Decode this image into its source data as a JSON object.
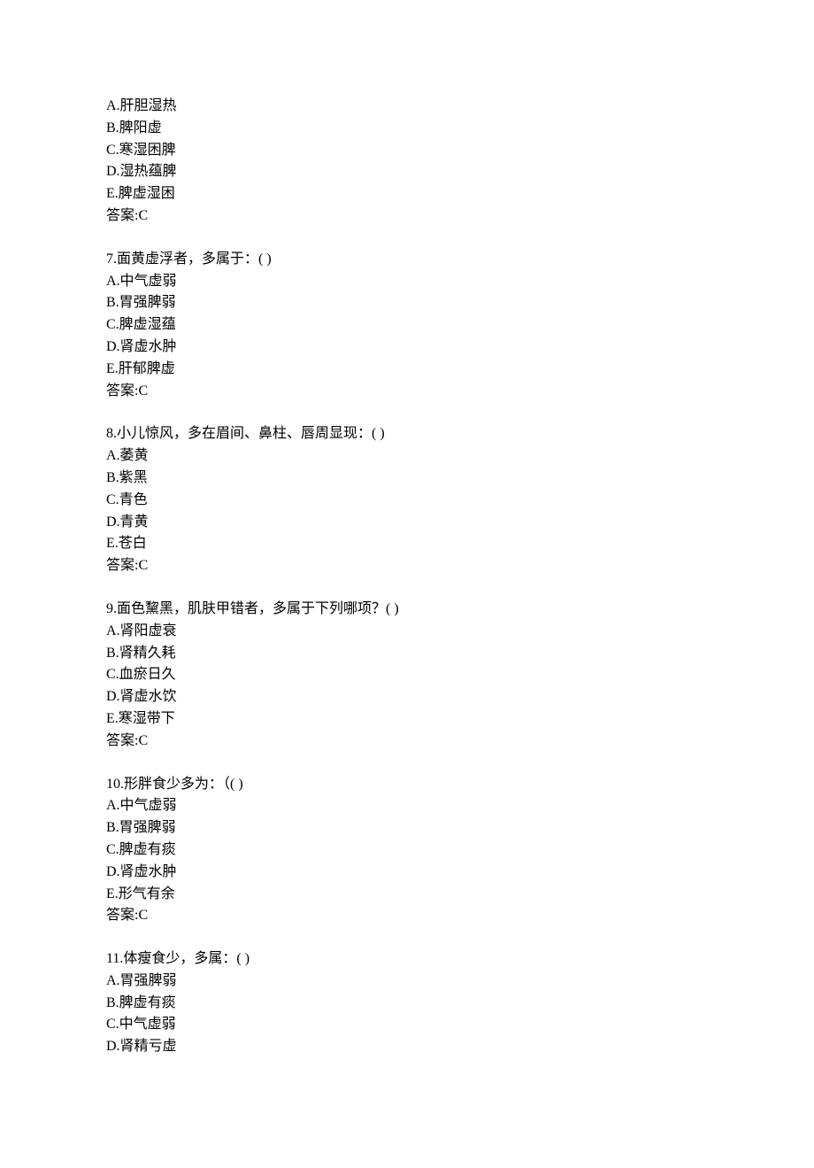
{
  "blocks": [
    {
      "lines": [
        "A.肝胆湿热",
        "B.脾阳虚",
        "C.寒湿困脾",
        "D.湿热蕴脾",
        "E.脾虚湿困",
        "答案:C"
      ]
    },
    {
      "lines": [
        "7.面黄虚浮者，多属于：( )",
        "A.中气虚弱",
        "B.胃强脾弱",
        "C.脾虚湿蕴",
        "D.肾虚水肿",
        "E.肝郁脾虚",
        "答案:C"
      ]
    },
    {
      "lines": [
        "8.小儿惊风，多在眉间、鼻柱、唇周显现：( )",
        "A.萎黄",
        "B.紫黑",
        "C.青色",
        "D.青黄",
        "E.苍白",
        "答案:C"
      ]
    },
    {
      "lines": [
        "9.面色黧黑，肌肤甲错者，多属于下列哪项？( )",
        "A.肾阳虚衰",
        "B.肾精久耗",
        "C.血瘀日久",
        "D.肾虚水饮",
        "E.寒湿带下",
        "答案:C"
      ]
    },
    {
      "lines": [
        "10.形胖食少多为：（( )",
        "A.中气虚弱",
        "B.胃强脾弱",
        "C.脾虚有痰",
        "D.肾虚水肿",
        "E.形气有余",
        "答案:C"
      ]
    },
    {
      "lines": [
        "11.体瘦食少，多属：( )",
        "A.胃强脾弱",
        "B.脾虚有痰",
        "C.中气虚弱",
        "D.肾精亏虚"
      ]
    }
  ]
}
